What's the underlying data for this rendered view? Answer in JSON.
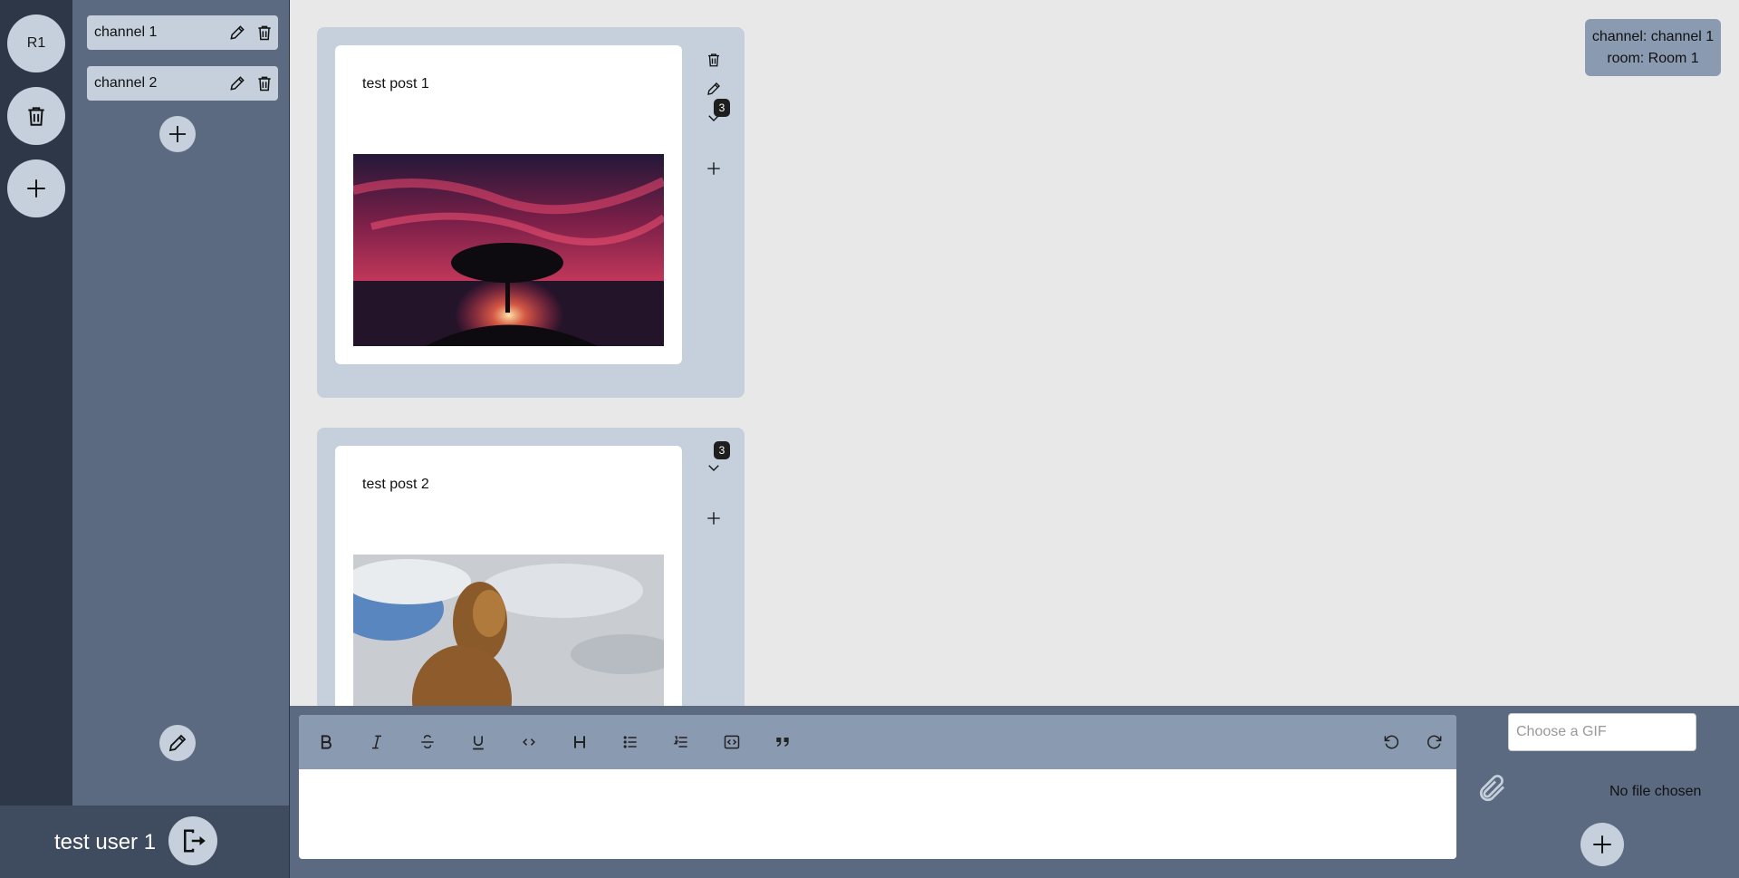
{
  "rooms": {
    "current_room_initials": "R1"
  },
  "channels": [
    {
      "label": "channel 1"
    },
    {
      "label": "channel 2"
    }
  ],
  "user": {
    "name": "test user 1"
  },
  "posts": [
    {
      "text": "test post 1",
      "badge_count": "3",
      "image": "sunset-tree"
    },
    {
      "text": "test post 2",
      "badge_count": "3",
      "image": "lion"
    }
  ],
  "context": {
    "channel_line": "channel: channel 1",
    "room_line": "room: Room 1"
  },
  "composer": {
    "gif_placeholder": "Choose a GIF",
    "file_status": "No file chosen",
    "toolbar": [
      "bold",
      "italic",
      "strikethrough",
      "underline",
      "code",
      "heading",
      "bullet-list",
      "ordered-list",
      "code-block",
      "blockquote",
      "undo",
      "redo"
    ]
  },
  "colors": {
    "rail": "#2d3748",
    "channels": "#5b6a80",
    "accent": "#c5d0dc",
    "toolbar": "#8a9ab0"
  }
}
